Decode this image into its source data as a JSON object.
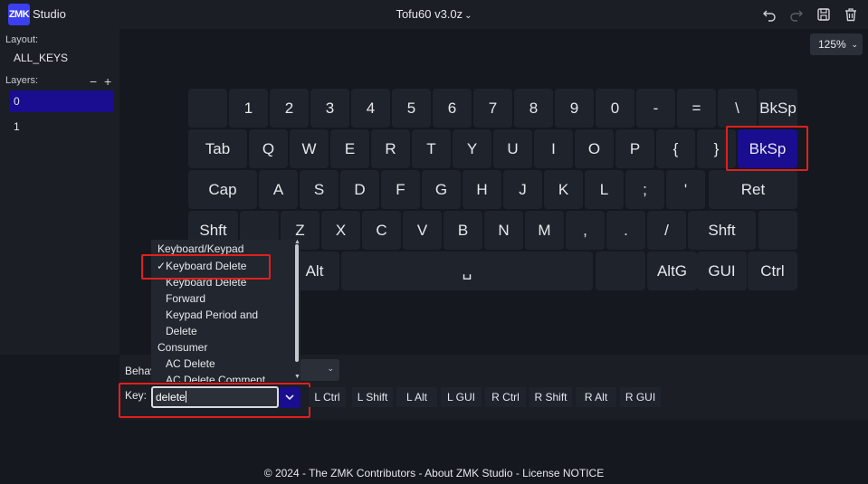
{
  "app": {
    "logo": "ZMK",
    "name": "Studio",
    "keyboard_title": "Tofu60 v3.0z",
    "zoom": "125%"
  },
  "toolbar": {
    "icons": [
      "undo-icon",
      "redo-icon",
      "save-icon",
      "trash-icon"
    ]
  },
  "sidebar": {
    "layout_label": "Layout:",
    "layout_value": "ALL_KEYS",
    "layers_label": "Layers:",
    "layer_remove": "−",
    "layer_add": "+",
    "layers": [
      "0",
      "1"
    ]
  },
  "keyboard": {
    "rows": [
      [
        "",
        "1",
        "2",
        "3",
        "4",
        "5",
        "6",
        "7",
        "8",
        "9",
        "0",
        "-",
        "=",
        "\\",
        "BkSp"
      ],
      [
        "Tab",
        "Q",
        "W",
        "E",
        "R",
        "T",
        "Y",
        "U",
        "I",
        "O",
        "P",
        "{",
        "}",
        "BkSp"
      ],
      [
        "Cap",
        "A",
        "S",
        "D",
        "F",
        "G",
        "H",
        "J",
        "K",
        "L",
        ";",
        "'",
        "Ret"
      ],
      [
        "Shft",
        "",
        "Z",
        "X",
        "C",
        "V",
        "B",
        "N",
        "M",
        ",",
        ".",
        "/",
        "Shft",
        ""
      ],
      [
        "",
        "Alt",
        "␣",
        "",
        "AltG",
        "GUI",
        "Ctrl"
      ]
    ],
    "selected_key": "BkSp"
  },
  "behavior": {
    "label": "Behav"
  },
  "key_picker": {
    "label": "Key:",
    "value": "delete",
    "modifiers": [
      "L Ctrl",
      "L Shift",
      "L Alt",
      "L GUI",
      "R Ctrl",
      "R Shift",
      "R Alt",
      "R GUI"
    ],
    "dropdown": {
      "group1": "Keyboard/Keypad",
      "items1": [
        "✓Keyboard Delete",
        "Keyboard Delete",
        "Forward",
        "Keypad Period and",
        "Delete"
      ],
      "group2": "Consumer",
      "items2": [
        "AC Delete",
        "AC Delete Comment"
      ]
    }
  },
  "footer": {
    "text": "© 2024 - The ZMK Contributors - About ZMK Studio - License NOTICE"
  },
  "colors": {
    "accent": "#1a0d8f",
    "highlight": "#e0201e",
    "background": "#15181e"
  }
}
